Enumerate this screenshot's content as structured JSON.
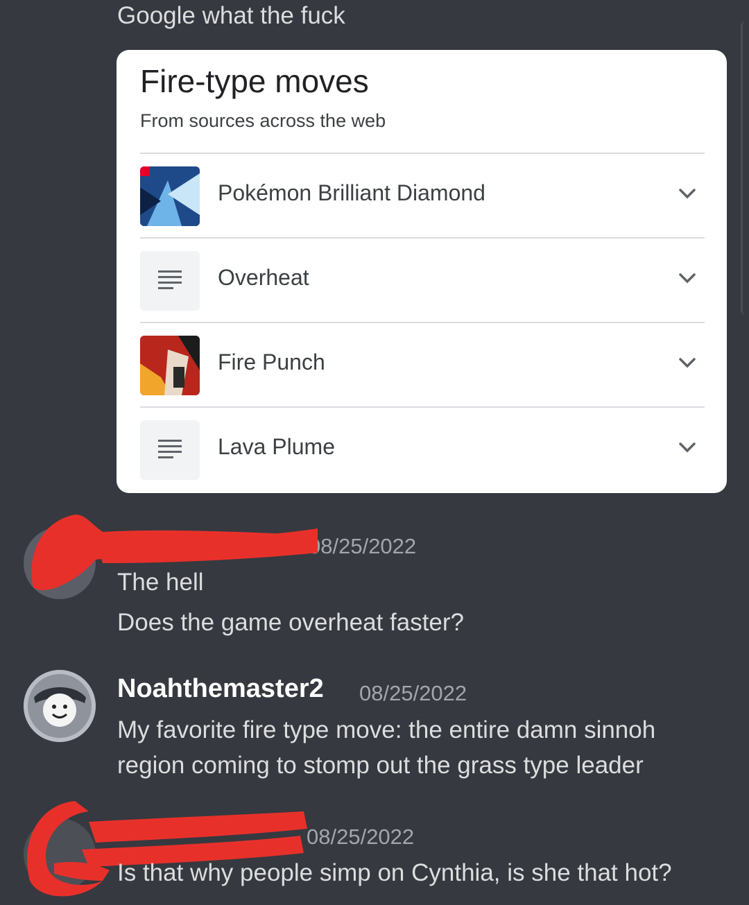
{
  "top_message": {
    "text": "Google what the fuck"
  },
  "google_card": {
    "title": "Fire-type moves",
    "subtitle": "From sources across the web",
    "items": [
      {
        "label": "Pokémon Brilliant Diamond",
        "icon": "game-cover-thumbnail"
      },
      {
        "label": "Overheat",
        "icon": "document-lines-icon"
      },
      {
        "label": "Fire Punch",
        "icon": "manga-cover-thumbnail"
      },
      {
        "label": "Lava Plume",
        "icon": "document-lines-icon"
      }
    ]
  },
  "messages": [
    {
      "author": "",
      "timestamp": "08/25/2022",
      "lines": [
        "The hell",
        "Does the game overheat faster?"
      ]
    },
    {
      "author": "Noahthemaster2",
      "timestamp": "08/25/2022",
      "lines": [
        "My favorite fire type move: the entire damn sinnoh",
        "region coming to stomp out the grass type leader"
      ]
    },
    {
      "author": "",
      "timestamp": "08/25/2022",
      "lines": [
        "Is that why people simp on Cynthia, is she that hot?"
      ]
    }
  ],
  "colors": {
    "background": "#36393f",
    "card": "#ffffff",
    "redaction": "#e8302b",
    "timestamp": "#a3a6aa"
  }
}
